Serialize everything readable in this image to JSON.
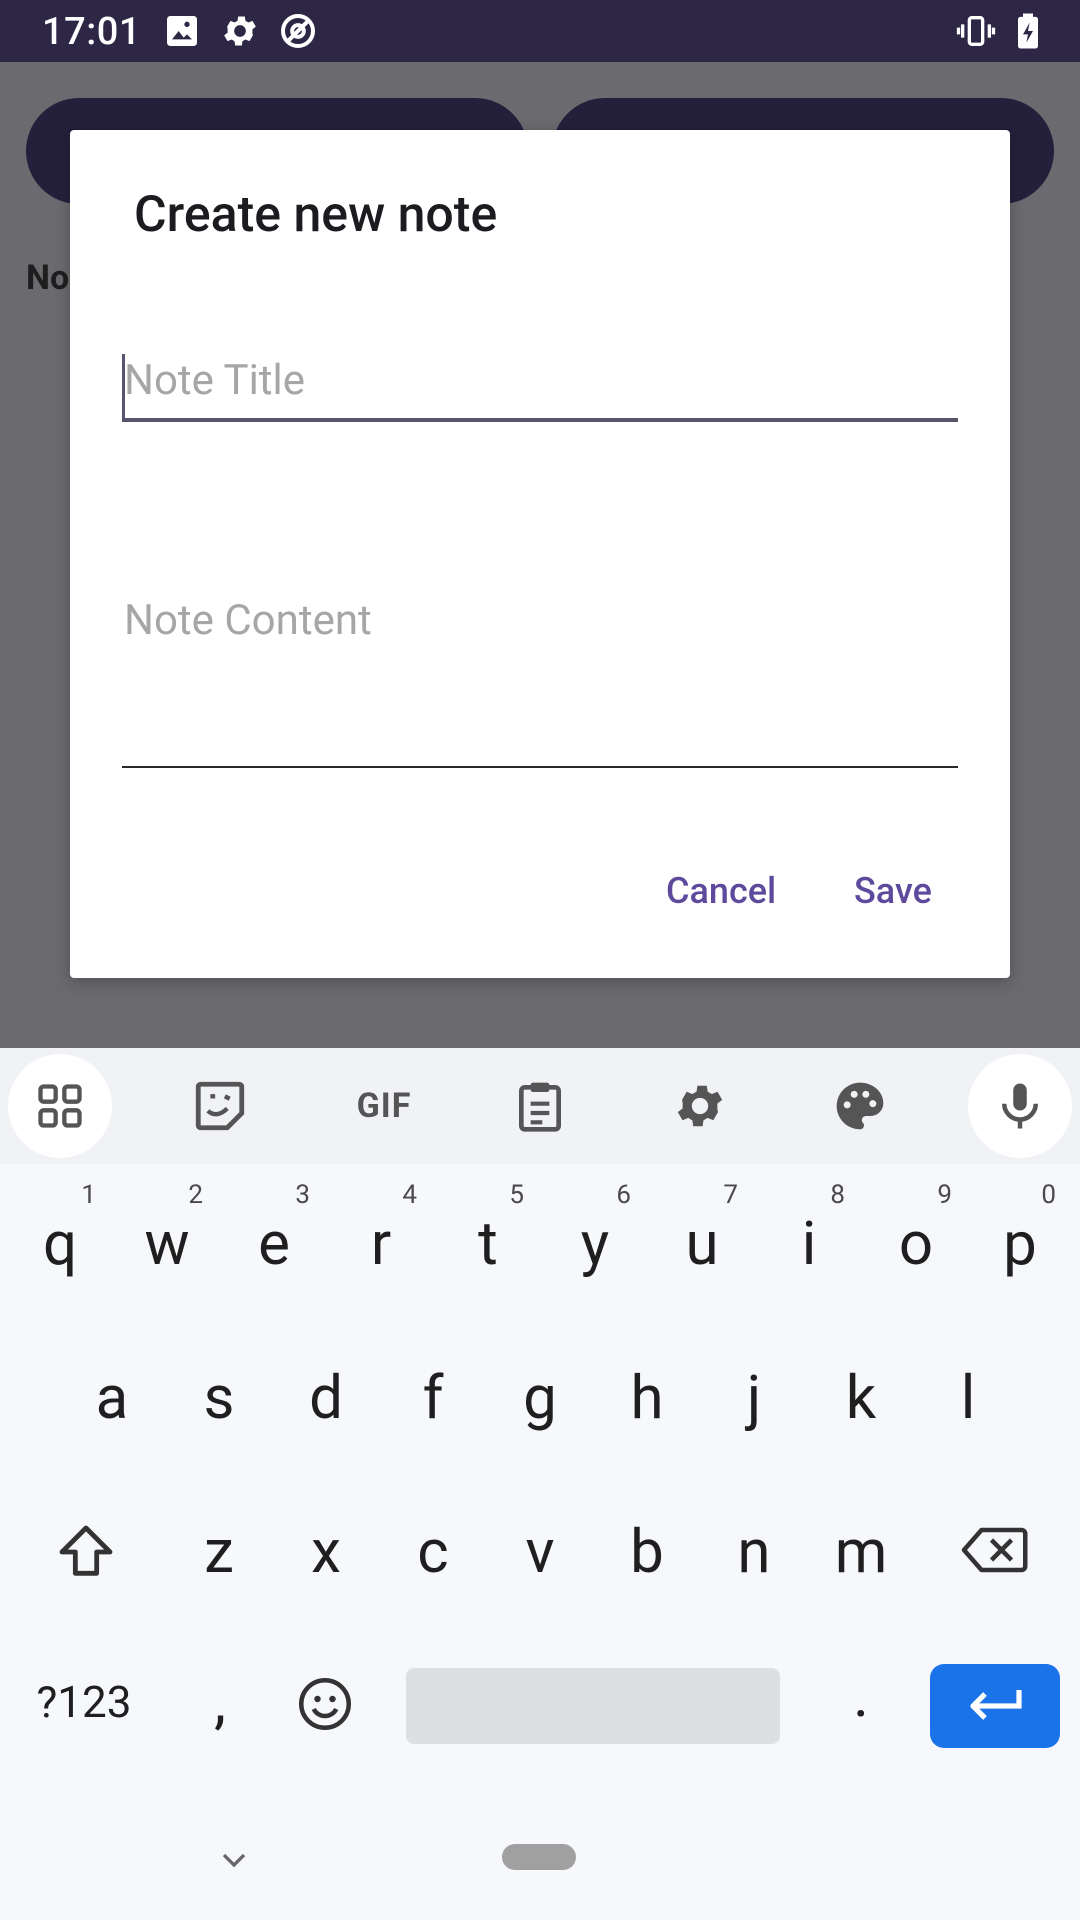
{
  "status_bar": {
    "time": "17:01",
    "left_icons": [
      "image-icon",
      "gear-icon",
      "location-off-icon"
    ],
    "right_icons": [
      "vibrate-icon",
      "battery-charging-icon"
    ]
  },
  "background": {
    "label_partial": "No"
  },
  "dialog": {
    "title": "Create new note",
    "title_field": {
      "placeholder": "Note Title",
      "value": ""
    },
    "content_field": {
      "placeholder": "Note Content",
      "value": ""
    },
    "cancel_label": "Cancel",
    "save_label": "Save"
  },
  "keyboard": {
    "toolbar_icons": [
      "apps-grid-icon",
      "sticker-icon",
      "gif-icon",
      "clipboard-icon",
      "settings-icon",
      "palette-icon",
      "mic-icon"
    ],
    "gif_label": "GIF",
    "row1": [
      {
        "k": "q",
        "h": "1"
      },
      {
        "k": "w",
        "h": "2"
      },
      {
        "k": "e",
        "h": "3"
      },
      {
        "k": "r",
        "h": "4"
      },
      {
        "k": "t",
        "h": "5"
      },
      {
        "k": "y",
        "h": "6"
      },
      {
        "k": "u",
        "h": "7"
      },
      {
        "k": "i",
        "h": "8"
      },
      {
        "k": "o",
        "h": "9"
      },
      {
        "k": "p",
        "h": "0"
      }
    ],
    "row2": [
      "a",
      "s",
      "d",
      "f",
      "g",
      "h",
      "j",
      "k",
      "l"
    ],
    "row3": [
      "z",
      "x",
      "c",
      "v",
      "b",
      "n",
      "m"
    ],
    "symbols_label": "?123",
    "comma": ",",
    "period": "."
  },
  "colors": {
    "status_bar": "#2d2645",
    "accent": "#5d4a9c",
    "enter_key": "#1a73e8"
  }
}
